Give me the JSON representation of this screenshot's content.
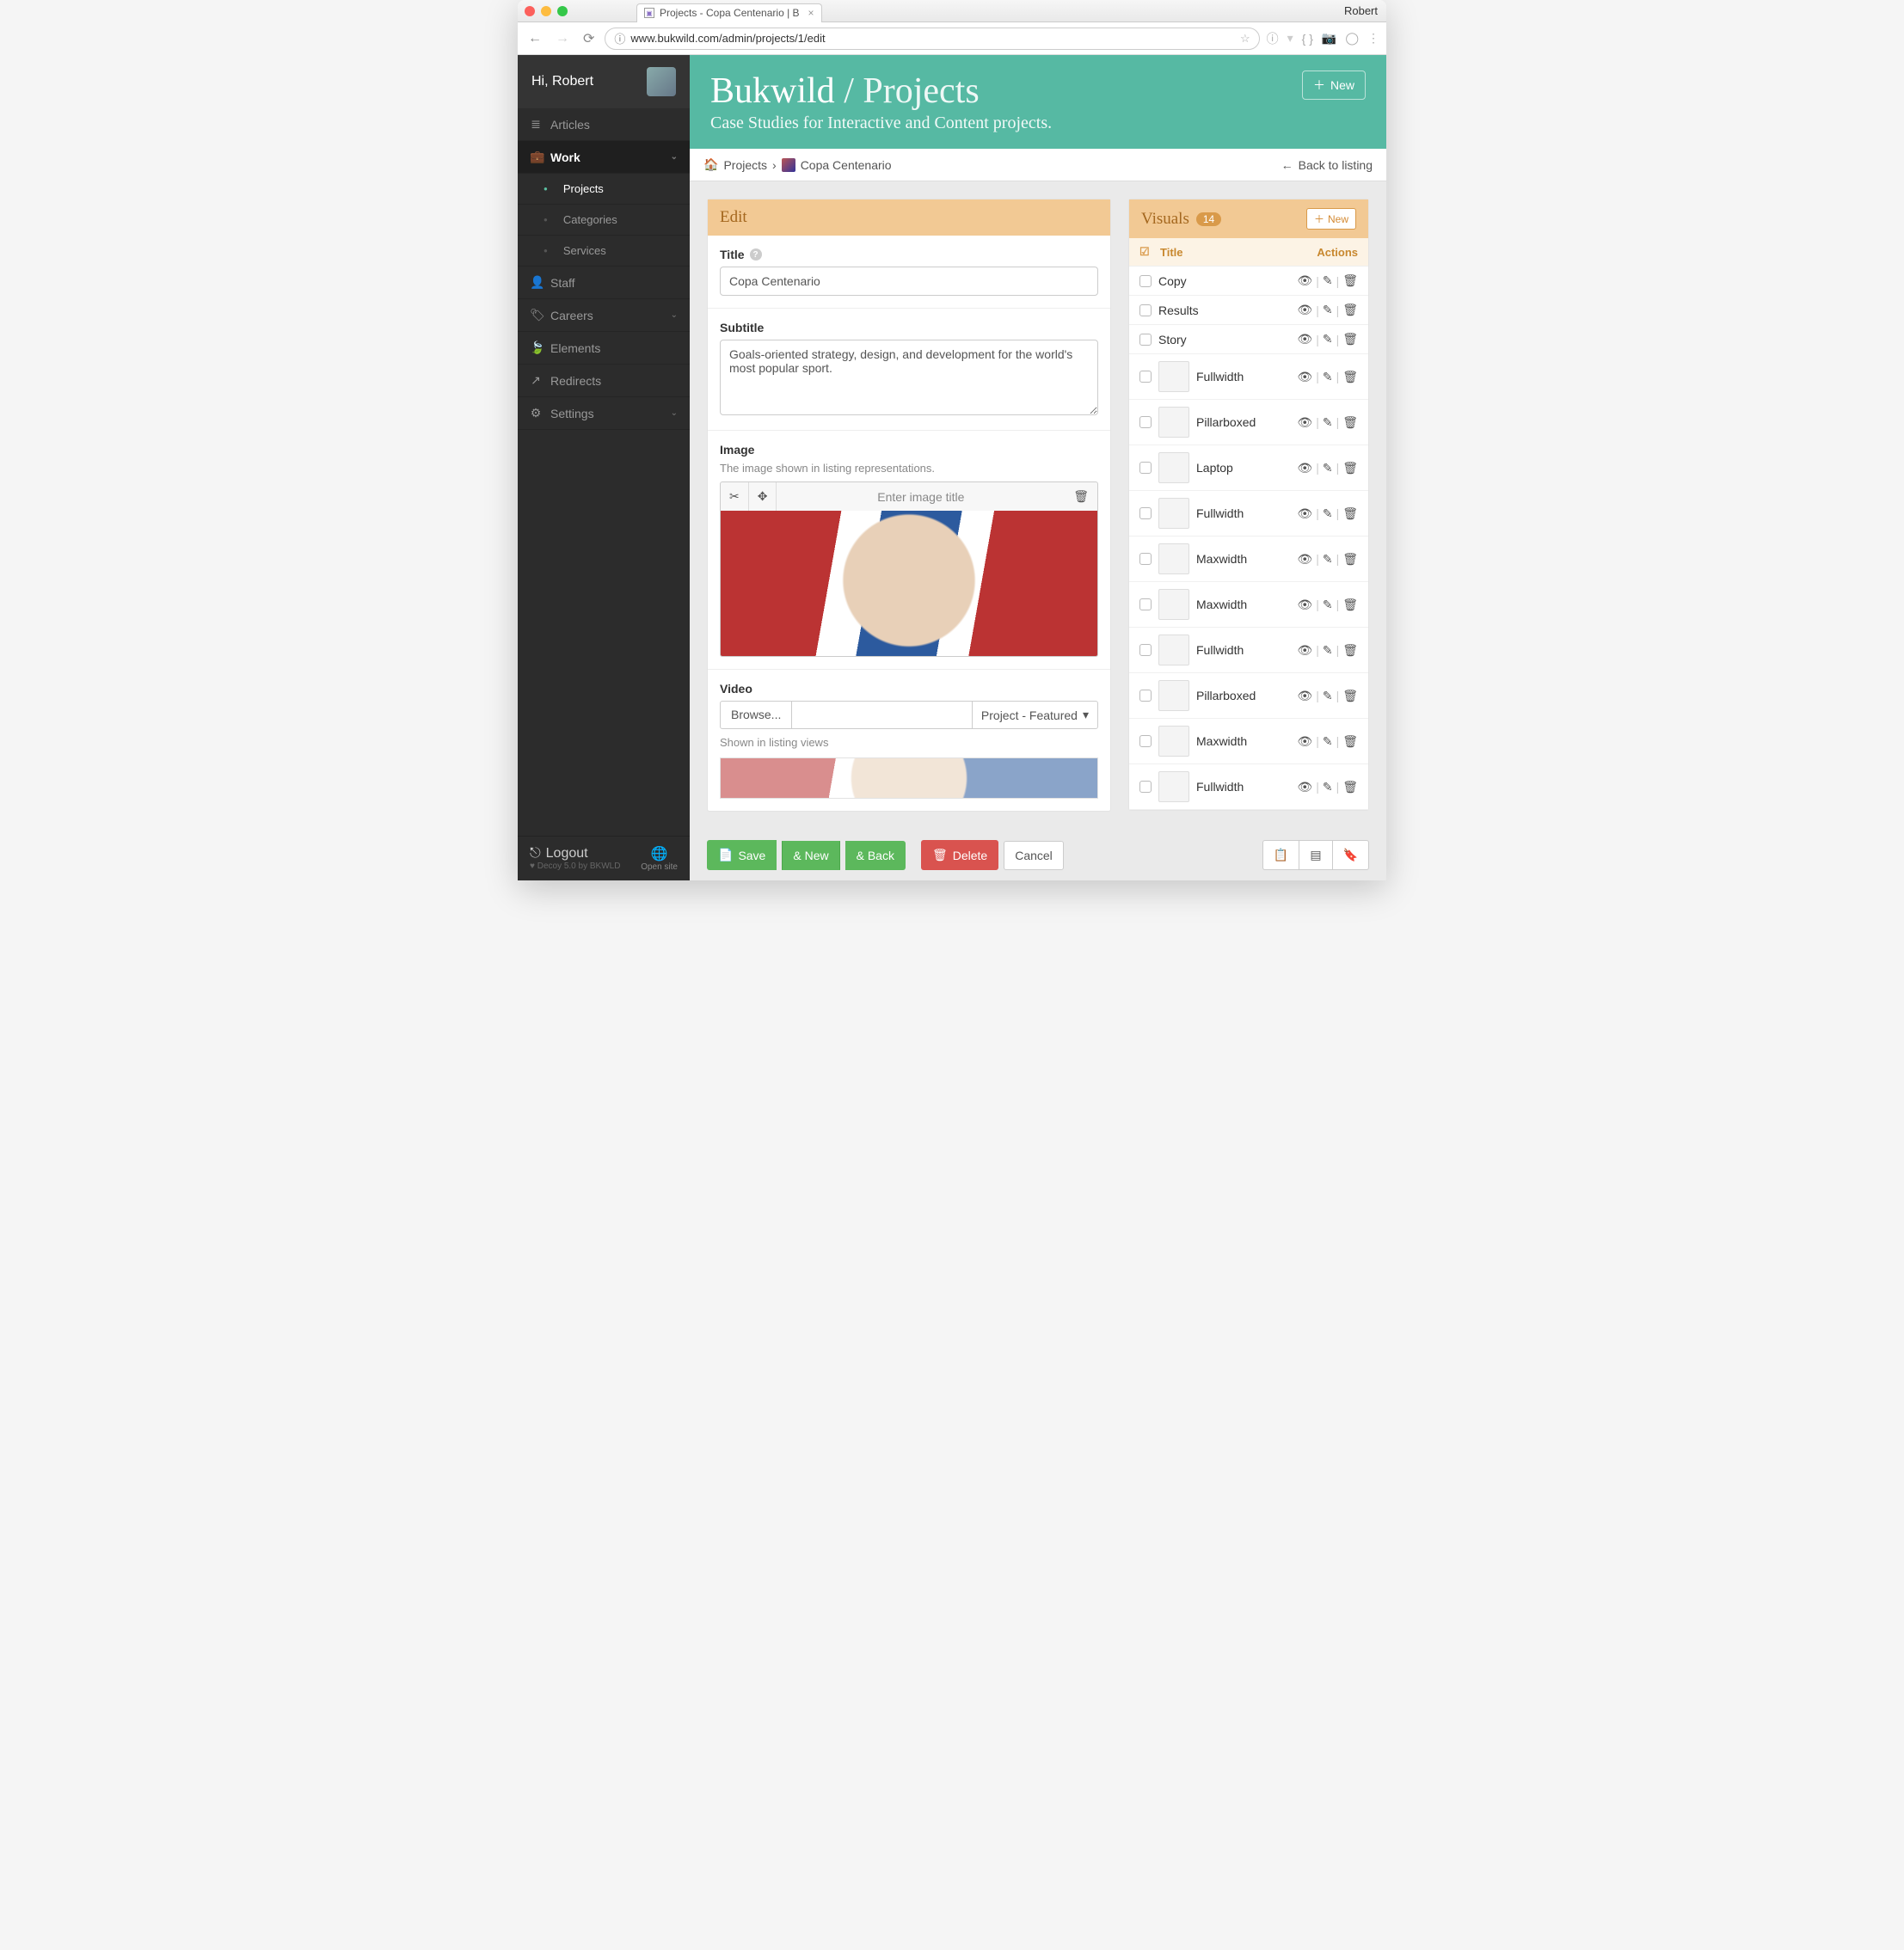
{
  "os_user": "Robert",
  "browser_tab": {
    "title": "Projects - Copa Centenario | B"
  },
  "url": "www.bukwild.com/admin/projects/1/edit",
  "sidebar": {
    "greeting": "Hi, Robert",
    "items": [
      {
        "label": "Articles",
        "icon": "≣"
      },
      {
        "label": "Work",
        "icon": "💼",
        "active_parent": true,
        "chev": true
      },
      {
        "label": "Projects",
        "sub": true,
        "active": true
      },
      {
        "label": "Categories",
        "sub": true
      },
      {
        "label": "Services",
        "sub": true
      },
      {
        "label": "Staff",
        "icon": "👤"
      },
      {
        "label": "Careers",
        "icon": "🏷",
        "chev": true
      },
      {
        "label": "Elements",
        "icon": "🍃"
      },
      {
        "label": "Redirects",
        "icon": "↗"
      },
      {
        "label": "Settings",
        "icon": "⚙",
        "chev": true
      }
    ],
    "logout": "Logout",
    "decoy": "Decoy 5.0 by BKWLD",
    "open_site": "Open site"
  },
  "hero": {
    "brand": "Bukwild",
    "section": "Projects",
    "subtitle": "Case Studies for Interactive and Content projects.",
    "new_label": "New"
  },
  "crumbs": {
    "root": "Projects",
    "leaf": "Copa Centenario",
    "back": "Back to listing"
  },
  "edit": {
    "heading": "Edit",
    "title_label": "Title",
    "title_value": "Copa Centenario",
    "subtitle_label": "Subtitle",
    "subtitle_value": "Goals-oriented strategy, design, and development for the world's most popular sport.",
    "image_label": "Image",
    "image_help": "The image shown in listing representations.",
    "image_title_placeholder": "Enter image title",
    "video_label": "Video",
    "browse": "Browse...",
    "video_drop": "Project - Featured",
    "video_help": "Shown in listing views"
  },
  "visuals": {
    "heading": "Visuals",
    "count": "14",
    "new_label": "New",
    "th_title": "Title",
    "th_actions": "Actions",
    "rows": [
      {
        "title": "Copy",
        "has_thumb": false
      },
      {
        "title": "Results",
        "has_thumb": false
      },
      {
        "title": "Story",
        "has_thumb": false
      },
      {
        "title": "Fullwidth",
        "has_thumb": true
      },
      {
        "title": "Pillarboxed",
        "has_thumb": true
      },
      {
        "title": "Laptop",
        "has_thumb": true
      },
      {
        "title": "Fullwidth",
        "has_thumb": true
      },
      {
        "title": "Maxwidth",
        "has_thumb": true
      },
      {
        "title": "Maxwidth",
        "has_thumb": true
      },
      {
        "title": "Fullwidth",
        "has_thumb": true
      },
      {
        "title": "Pillarboxed",
        "has_thumb": true
      },
      {
        "title": "Maxwidth",
        "has_thumb": true
      },
      {
        "title": "Fullwidth",
        "has_thumb": true
      }
    ]
  },
  "actions": {
    "save": "Save",
    "and_new": "& New",
    "and_back": "& Back",
    "delete": "Delete",
    "cancel": "Cancel"
  }
}
